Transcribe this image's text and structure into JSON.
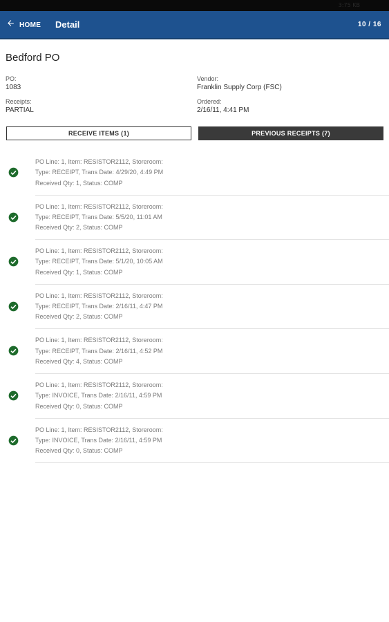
{
  "status_bar": {
    "text": "3:75 KB"
  },
  "header": {
    "back_label": "HOME",
    "title": "Detail",
    "pager": "10 / 16"
  },
  "page_title": "Bedford PO",
  "fields": {
    "po": {
      "label": "PO:",
      "value": "1083"
    },
    "vendor": {
      "label": "Vendor:",
      "value": "Franklin Supply Corp (FSC)"
    },
    "receipts": {
      "label": "Receipts:",
      "value": "PARTIAL"
    },
    "ordered": {
      "label": "Ordered:",
      "value": "2/16/11, 4:41 PM"
    }
  },
  "buttons": {
    "receive_items": "RECEIVE ITEMS (1)",
    "previous_receipts": "PREVIOUS RECEIPTS (7)"
  },
  "receipts_list": [
    {
      "line1": "PO Line: 1, Item: RESISTOR2112, Storeroom:",
      "line2": "Type: RECEIPT, Trans Date: 4/29/20, 4:49 PM",
      "line3": "Received Qty: 1, Status: COMP",
      "icon": "check-circle-icon"
    },
    {
      "line1": "PO Line: 1, Item: RESISTOR2112, Storeroom:",
      "line2": "Type: RECEIPT, Trans Date: 5/5/20, 11:01 AM",
      "line3": "Received Qty: 2, Status: COMP",
      "icon": "check-circle-icon"
    },
    {
      "line1": "PO Line: 1, Item: RESISTOR2112, Storeroom:",
      "line2": "Type: RECEIPT, Trans Date: 5/1/20, 10:05 AM",
      "line3": "Received Qty: 1, Status: COMP",
      "icon": "check-circle-icon"
    },
    {
      "line1": "PO Line: 1, Item: RESISTOR2112, Storeroom:",
      "line2": "Type: RECEIPT, Trans Date: 2/16/11, 4:47 PM",
      "line3": "Received Qty: 2, Status: COMP",
      "icon": "check-circle-icon"
    },
    {
      "line1": "PO Line: 1, Item: RESISTOR2112, Storeroom:",
      "line2": "Type: RECEIPT, Trans Date: 2/16/11, 4:52 PM",
      "line3": "Received Qty: 4, Status: COMP",
      "icon": "check-circle-icon"
    },
    {
      "line1": "PO Line: 1, Item: RESISTOR2112, Storeroom:",
      "line2": "Type: INVOICE, Trans Date: 2/16/11, 4:59 PM",
      "line3": "Received Qty: 0, Status: COMP",
      "icon": "check-circle-icon"
    },
    {
      "line1": "PO Line: 1, Item: RESISTOR2112, Storeroom:",
      "line2": "Type: INVOICE, Trans Date: 2/16/11, 4:59 PM",
      "line3": "Received Qty: 0, Status: COMP",
      "icon": "check-circle-icon"
    }
  ],
  "colors": {
    "app_bar": "#1e528f",
    "check_green": "#1e6b2c",
    "button_dark": "#3a3a3a"
  }
}
